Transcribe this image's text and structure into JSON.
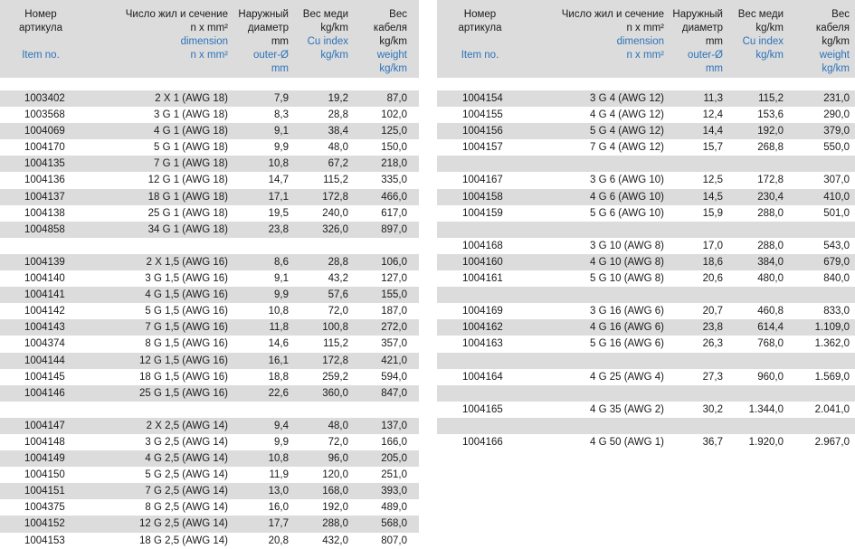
{
  "headers": {
    "item": {
      "ru": [
        "Номер",
        "артикула"
      ],
      "en": [
        "Item no."
      ]
    },
    "dimension": {
      "ru": [
        "Число жил и сечение",
        "n x mm²"
      ],
      "en": [
        "dimension",
        "n x mm²"
      ]
    },
    "diameter": {
      "ru": [
        "Наружный",
        "диаметр",
        "mm"
      ],
      "en": [
        "outer-Ø",
        "mm"
      ]
    },
    "copper": {
      "ru": [
        "Вес меди",
        "kg/km"
      ],
      "en": [
        "Cu index",
        "kg/km"
      ]
    },
    "weight": {
      "ru": [
        "Вес",
        "кабеля",
        "kg/km"
      ],
      "en": [
        "weight",
        "kg/km"
      ]
    }
  },
  "colors": {
    "shade": "#dcdcdc",
    "english_text": "#2d73b9"
  },
  "left_rows": [
    [
      "1003402",
      "2 X 1 (AWG 18)",
      "7,9",
      "19,2",
      "87,0"
    ],
    [
      "1003568",
      "3 G 1 (AWG 18)",
      "8,3",
      "28,8",
      "102,0"
    ],
    [
      "1004069",
      "4 G 1 (AWG 18)",
      "9,1",
      "38,4",
      "125,0"
    ],
    [
      "1004170",
      "5 G 1 (AWG 18)",
      "9,9",
      "48,0",
      "150,0"
    ],
    [
      "1004135",
      "7 G 1 (AWG 18)",
      "10,8",
      "67,2",
      "218,0"
    ],
    [
      "1004136",
      "12 G 1 (AWG 18)",
      "14,7",
      "115,2",
      "335,0"
    ],
    [
      "1004137",
      "18 G 1 (AWG 18)",
      "17,1",
      "172,8",
      "466,0"
    ],
    [
      "1004138",
      "25 G 1 (AWG 18)",
      "19,5",
      "240,0",
      "617,0"
    ],
    [
      "1004858",
      "34 G 1 (AWG 18)",
      "23,8",
      "326,0",
      "897,0"
    ],
    [],
    [
      "1004139",
      "2 X 1,5 (AWG 16)",
      "8,6",
      "28,8",
      "106,0"
    ],
    [
      "1004140",
      "3 G 1,5 (AWG 16)",
      "9,1",
      "43,2",
      "127,0"
    ],
    [
      "1004141",
      "4 G 1,5 (AWG 16)",
      "9,9",
      "57,6",
      "155,0"
    ],
    [
      "1004142",
      "5 G 1,5 (AWG 16)",
      "10,8",
      "72,0",
      "187,0"
    ],
    [
      "1004143",
      "7 G 1,5 (AWG 16)",
      "11,8",
      "100,8",
      "272,0"
    ],
    [
      "1004374",
      "8 G 1,5 (AWG 16)",
      "14,6",
      "115,2",
      "357,0"
    ],
    [
      "1004144",
      "12 G 1,5 (AWG 16)",
      "16,1",
      "172,8",
      "421,0"
    ],
    [
      "1004145",
      "18 G 1,5 (AWG 16)",
      "18,8",
      "259,2",
      "594,0"
    ],
    [
      "1004146",
      "25 G 1,5 (AWG 16)",
      "22,6",
      "360,0",
      "847,0"
    ],
    [],
    [
      "1004147",
      "2 X 2,5 (AWG 14)",
      "9,4",
      "48,0",
      "137,0"
    ],
    [
      "1004148",
      "3 G 2,5 (AWG 14)",
      "9,9",
      "72,0",
      "166,0"
    ],
    [
      "1004149",
      "4 G 2,5 (AWG 14)",
      "10,8",
      "96,0",
      "205,0"
    ],
    [
      "1004150",
      "5 G 2,5 (AWG 14)",
      "11,9",
      "120,0",
      "251,0"
    ],
    [
      "1004151",
      "7 G 2,5 (AWG 14)",
      "13,0",
      "168,0",
      "393,0"
    ],
    [
      "1004375",
      "8 G 2,5 (AWG 14)",
      "16,0",
      "192,0",
      "489,0"
    ],
    [
      "1004152",
      "12 G 2,5 (AWG 14)",
      "17,7",
      "288,0",
      "568,0"
    ],
    [
      "1004153",
      "18 G 2,5 (AWG 14)",
      "20,8",
      "432,0",
      "807,0"
    ]
  ],
  "right_rows": [
    [
      "1004154",
      "3 G 4 (AWG 12)",
      "11,3",
      "115,2",
      "231,0"
    ],
    [
      "1004155",
      "4 G 4 (AWG 12)",
      "12,4",
      "153,6",
      "290,0"
    ],
    [
      "1004156",
      "5 G 4 (AWG 12)",
      "14,4",
      "192,0",
      "379,0"
    ],
    [
      "1004157",
      "7 G 4 (AWG 12)",
      "15,7",
      "268,8",
      "550,0"
    ],
    [],
    [
      "1004167",
      "3 G 6 (AWG 10)",
      "12,5",
      "172,8",
      "307,0"
    ],
    [
      "1004158",
      "4 G 6 (AWG 10)",
      "14,5",
      "230,4",
      "410,0"
    ],
    [
      "1004159",
      "5 G 6 (AWG 10)",
      "15,9",
      "288,0",
      "501,0"
    ],
    [],
    [
      "1004168",
      "3 G 10 (AWG 8)",
      "17,0",
      "288,0",
      "543,0"
    ],
    [
      "1004160",
      "4 G 10 (AWG 8)",
      "18,6",
      "384,0",
      "679,0"
    ],
    [
      "1004161",
      "5 G 10 (AWG 8)",
      "20,6",
      "480,0",
      "840,0"
    ],
    [],
    [
      "1004169",
      "3 G 16 (AWG 6)",
      "20,7",
      "460,8",
      "833,0"
    ],
    [
      "1004162",
      "4 G 16 (AWG 6)",
      "23,8",
      "614,4",
      "1.109,0"
    ],
    [
      "1004163",
      "5 G 16 (AWG 6)",
      "26,3",
      "768,0",
      "1.362,0"
    ],
    [],
    [
      "1004164",
      "4 G 25 (AWG 4)",
      "27,3",
      "960,0",
      "1.569,0"
    ],
    [],
    [
      "1004165",
      "4 G 35 (AWG 2)",
      "30,2",
      "1.344,0",
      "2.041,0"
    ],
    [],
    [
      "1004166",
      "4 G 50 (AWG 1)",
      "36,7",
      "1.920,0",
      "2.967,0"
    ]
  ]
}
